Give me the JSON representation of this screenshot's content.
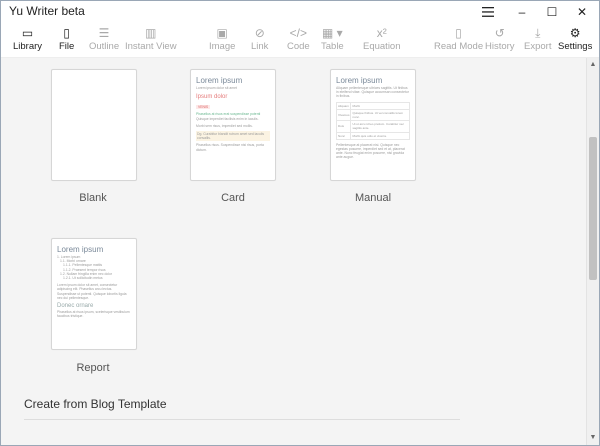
{
  "app": {
    "title": "Yu Writer beta"
  },
  "window_controls": {
    "menu_icon": "hamburger-icon",
    "minimize": "–",
    "maximize": "☐",
    "close": "✕"
  },
  "toolbar": [
    {
      "label": "Library",
      "icon": "▭"
    },
    {
      "label": "File",
      "icon": "▯"
    },
    {
      "label": "Outline",
      "icon": "☰"
    },
    {
      "label": "Instant View",
      "icon": "▥"
    },
    {
      "label": "Image",
      "icon": "▣"
    },
    {
      "label": "Link",
      "icon": "⊘"
    },
    {
      "label": "Code",
      "icon": "</>"
    },
    {
      "label": "Table",
      "icon": "▦ ▾"
    },
    {
      "label": "Equation",
      "icon": "x²"
    },
    {
      "label": "Read Mode",
      "icon": "▯"
    },
    {
      "label": "History",
      "icon": "↺"
    },
    {
      "label": "Export",
      "icon": "⤓"
    },
    {
      "label": "Settings",
      "icon": "⚙"
    }
  ],
  "templates": [
    {
      "label": "Blank"
    },
    {
      "label": "Card",
      "preview": {
        "title": "Lorem ipsum",
        "line1": "Lorem ipsum dolor sit amet",
        "subtitle": "Ipsum dolor",
        "tag": "VENIS",
        "green": "Phasellus at risus erat suspendisse potenti",
        "line2": "Quisque imperdiet facilisis enim in iaculis.",
        "line3": "Morbi sem risus, imperdiet sed mollis.",
        "note": "Dg. Curabitur blandit rutrum amet sed laculis convallis.",
        "line4": "Phasellus risus. Suspendisse nisi risus, porta dictum."
      }
    },
    {
      "label": "Manual",
      "preview": {
        "title": "Lorem ipsum",
        "intro": "Aliquam pellentesque ultrices sagittis. Ut finibus in eleifend vitae. Quisque accumsan consectetur in finibus.",
        "th1": "Aliquam",
        "th2": "Morbi",
        "r1a": "Vivamus",
        "r1b": "Quisque finibus. Ut vel convallis lorem nunc.",
        "r2a": "Duis",
        "r2b": "Ut ut arcu id leo pretium. Curabitur nec sagittis ante.",
        "r3a": "Nunc",
        "r3b": "Morbi quis odio et viverra.",
        "outro": "Pellentesque at placerat nisi. Quisque nec egestas posuere, imperdiet sed et at, placerat ante. Nunc feugiat enim posuere, nisl gravida ante augue."
      }
    },
    {
      "label": "Report",
      "preview": {
        "title": "Lorem ipsum",
        "toc1": "1. Lorem ipsum",
        "toc2": "1.1. Morbi ornare",
        "toc3": "1.1.1. Pellentesque mattis",
        "toc4": "1.1.2. Praesent tempor risus",
        "toc5": "1.2. Nullam fringilla enim nec dolor",
        "toc6": "1.2.1. Ut sollicitudin metus",
        "para": "Lorem ipsum dolor sit amet, consectetur adipiscing elit. Phasellus arcu lectus. Suspendisse ut potenti. Quisque lobortis ligula nec dui pellentesque.",
        "subtitle": "Donec ornare",
        "para2": "Phasellus at risus ipsum, scelerisque vestibulum faucibus tristique."
      }
    }
  ],
  "section": {
    "title": "Create from Blog Template"
  }
}
